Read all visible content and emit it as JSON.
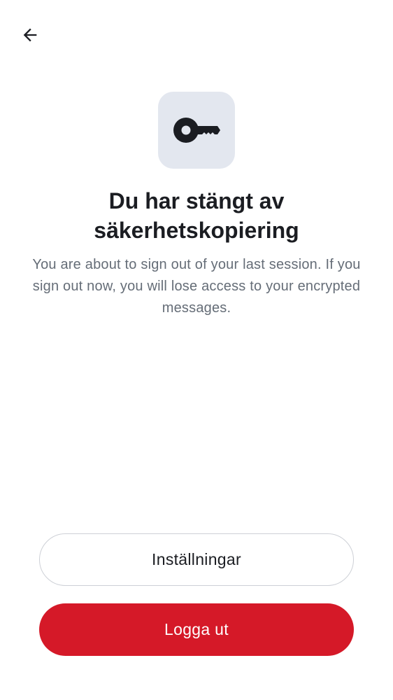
{
  "header": {
    "back_icon": "arrow-left-icon"
  },
  "hero": {
    "icon": "key-icon",
    "tile_color": "#e3e7ef"
  },
  "content": {
    "title_line1": "Du har stängt av",
    "title_line2": "säkerhetskopiering",
    "description": "You are about to sign out of your last session. If you sign out now, you will lose access to your encrypted messages."
  },
  "actions": {
    "settings_label": "Inställningar",
    "signout_label": "Logga ut",
    "signout_color": "#d51928"
  }
}
